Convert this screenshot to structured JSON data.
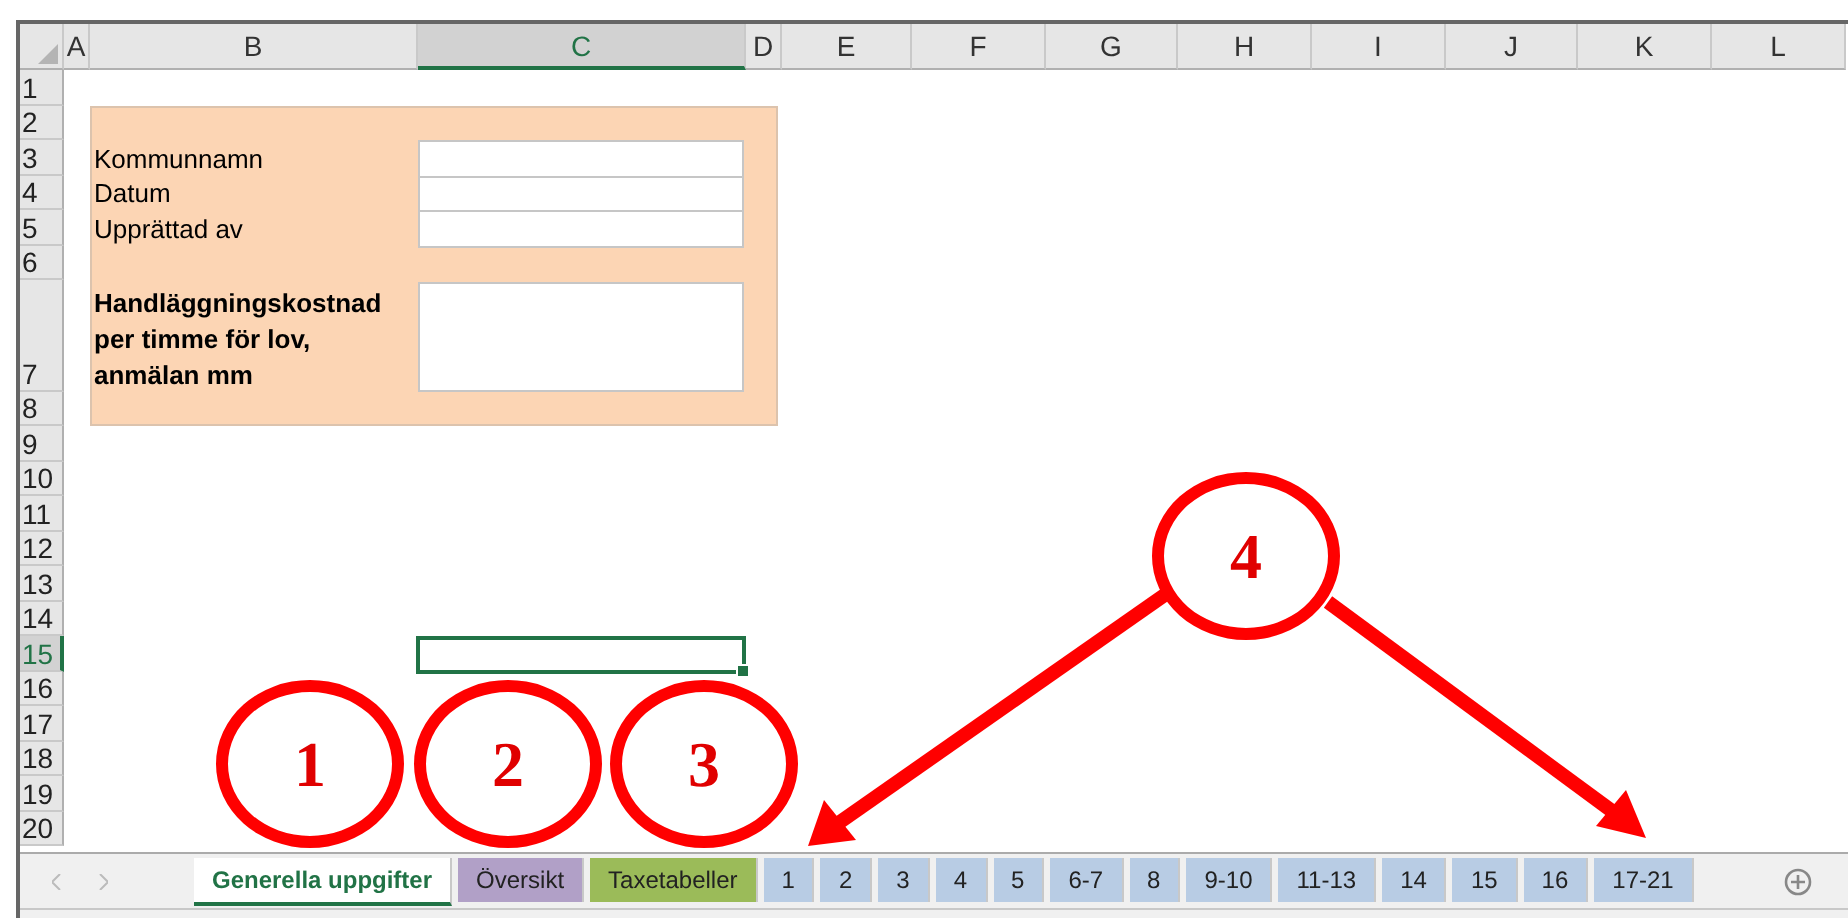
{
  "column_headers": [
    {
      "label": "A",
      "selected": false
    },
    {
      "label": "B",
      "selected": false
    },
    {
      "label": "C",
      "selected": true
    },
    {
      "label": "D",
      "selected": false
    },
    {
      "label": "E",
      "selected": false
    },
    {
      "label": "F",
      "selected": false
    },
    {
      "label": "G",
      "selected": false
    },
    {
      "label": "H",
      "selected": false
    },
    {
      "label": "I",
      "selected": false
    },
    {
      "label": "J",
      "selected": false
    },
    {
      "label": "K",
      "selected": false
    },
    {
      "label": "L",
      "selected": false
    }
  ],
  "row_headers": [
    {
      "label": "1",
      "selected": false
    },
    {
      "label": "2",
      "selected": false
    },
    {
      "label": "3",
      "selected": false
    },
    {
      "label": "4",
      "selected": false
    },
    {
      "label": "5",
      "selected": false
    },
    {
      "label": "6",
      "selected": false
    },
    {
      "label": "7",
      "selected": false
    },
    {
      "label": "8",
      "selected": false
    },
    {
      "label": "9",
      "selected": false
    },
    {
      "label": "10",
      "selected": false
    },
    {
      "label": "11",
      "selected": false
    },
    {
      "label": "12",
      "selected": false
    },
    {
      "label": "13",
      "selected": false
    },
    {
      "label": "14",
      "selected": false
    },
    {
      "label": "15",
      "selected": true
    },
    {
      "label": "16",
      "selected": false
    },
    {
      "label": "17",
      "selected": false
    },
    {
      "label": "18",
      "selected": false
    },
    {
      "label": "19",
      "selected": false
    },
    {
      "label": "20",
      "selected": false
    }
  ],
  "form": {
    "fields": [
      {
        "label": "Kommunnamn",
        "kind": "single"
      },
      {
        "label": "Datum",
        "kind": "single"
      },
      {
        "label": "Upprättad av",
        "kind": "single"
      },
      {
        "label": "Handläggningskostnad per timme för lov, anmälan mm",
        "kind": "multiline"
      }
    ]
  },
  "sheet_tabs": [
    {
      "label": "Generella uppgifter",
      "selected": true
    },
    {
      "label": "Översikt",
      "selected": false,
      "color": "#b1a0c7"
    },
    {
      "label": "Taxetabeller",
      "selected": false,
      "color": "#9bbb59"
    },
    {
      "label": "1",
      "selected": false,
      "color": "#b8cce4"
    },
    {
      "label": "2",
      "selected": false,
      "color": "#b8cce4"
    },
    {
      "label": "3",
      "selected": false,
      "color": "#b8cce4"
    },
    {
      "label": "4",
      "selected": false,
      "color": "#b8cce4"
    },
    {
      "label": "5",
      "selected": false,
      "color": "#b8cce4"
    },
    {
      "label": "6-7",
      "selected": false,
      "color": "#b8cce4"
    },
    {
      "label": "8",
      "selected": false,
      "color": "#b8cce4"
    },
    {
      "label": "9-10",
      "selected": false,
      "color": "#b8cce4"
    },
    {
      "label": "11-13",
      "selected": false,
      "color": "#b8cce4"
    },
    {
      "label": "14",
      "selected": false,
      "color": "#b8cce4"
    },
    {
      "label": "15",
      "selected": false,
      "color": "#b8cce4"
    },
    {
      "label": "16",
      "selected": false,
      "color": "#b8cce4"
    },
    {
      "label": "17-21",
      "selected": false,
      "color": "#b8cce4"
    }
  ],
  "annotations": [
    {
      "label": "1"
    },
    {
      "label": "2"
    },
    {
      "label": "3"
    },
    {
      "label": "4"
    }
  ]
}
